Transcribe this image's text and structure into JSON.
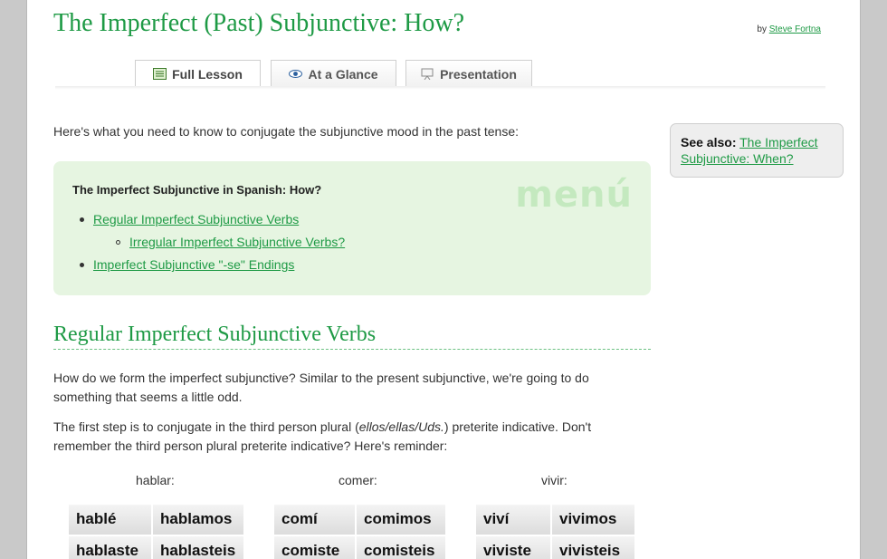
{
  "header": {
    "title": "The Imperfect (Past) Subjunctive: How?",
    "by_label": "by",
    "author": "Steve Fortna"
  },
  "tabs": [
    {
      "label": "Full Lesson",
      "icon": "lesson-icon",
      "active": true
    },
    {
      "label": "At a Glance",
      "icon": "eye-icon",
      "active": false
    },
    {
      "label": "Presentation",
      "icon": "presentation-icon",
      "active": false
    }
  ],
  "intro": "Here's what you need to know to conjugate the subjunctive mood in the past tense:",
  "menu": {
    "watermark": "menú",
    "title": "The Imperfect Subjunctive in Spanish: How?",
    "items": [
      {
        "label": "Regular Imperfect Subjunctive Verbs"
      },
      {
        "label": "Irregular Imperfect Subjunctive Verbs?"
      },
      {
        "label": "Imperfect Subjunctive \"-se\" Endings"
      }
    ]
  },
  "see_also": {
    "label": "See also:",
    "link": "The Imperfect Subjunctive: When?"
  },
  "section": {
    "heading": "Regular Imperfect Subjunctive Verbs",
    "para1": "How do we form the imperfect subjunctive? Similar to the present subjunctive, we're going to do something that seems a little odd.",
    "para2_a": "The first step is to conjugate in the third person plural (",
    "para2_em": "ellos/ellas/Uds.",
    "para2_b": ") preterite indicative. Don't remember the third person plural preterite indicative? Here's reminder:"
  },
  "verbs": [
    {
      "label": "hablar:",
      "forms": [
        "hablé",
        "hablamos",
        "hablaste",
        "hablasteis"
      ]
    },
    {
      "label": "comer:",
      "forms": [
        "comí",
        "comimos",
        "comiste",
        "comisteis"
      ]
    },
    {
      "label": "vivir:",
      "forms": [
        "viví",
        "vivimos",
        "viviste",
        "vivisteis"
      ]
    }
  ],
  "colors": {
    "accent": "#1e9a45",
    "menu_bg": "#e6f5e1"
  }
}
